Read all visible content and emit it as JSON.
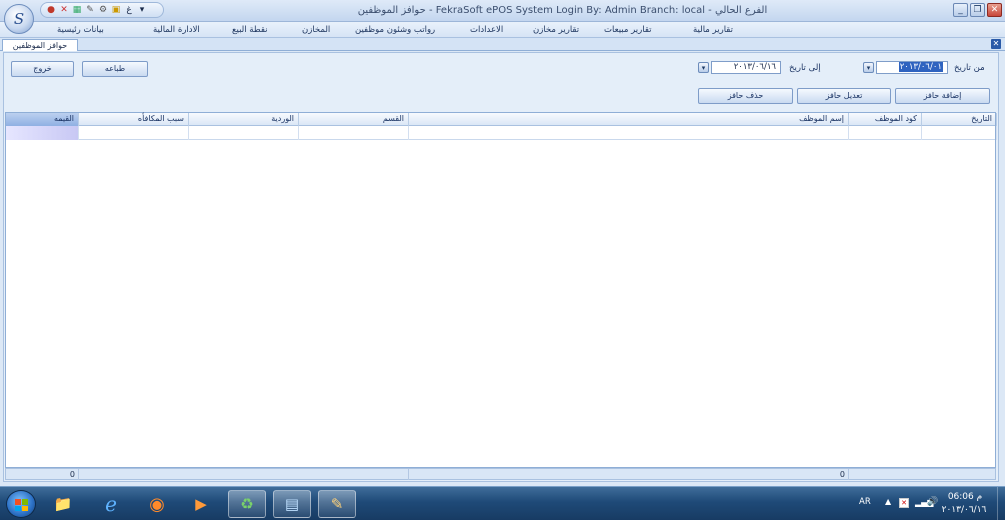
{
  "window": {
    "title": "حوافز الموظفين - FekraSoft ePOS System   Login By: Admin   Branch: local - الفرع الحالي",
    "orb_glyph": "S"
  },
  "qat": [
    "●",
    "✕",
    "▦",
    "✎",
    "⚙",
    "▣",
    "غ",
    "▾"
  ],
  "menu": [
    {
      "id": "financial-reports",
      "label": "تقارير مالية"
    },
    {
      "id": "sales-reports",
      "label": "تقارير مبيعات"
    },
    {
      "id": "stock-reports",
      "label": "تقارير مخازن"
    },
    {
      "id": "settings",
      "label": "الاعدادات"
    },
    {
      "id": "payroll",
      "label": "رواتب وشئون موظفين"
    },
    {
      "id": "stores",
      "label": "المخازن"
    },
    {
      "id": "pos",
      "label": "نقطة البيع"
    },
    {
      "id": "finance",
      "label": "الادارة المالية"
    },
    {
      "id": "master-data",
      "label": "بيانات رئيسية"
    }
  ],
  "tab": {
    "label": "حوافز الموظفين"
  },
  "filters": {
    "from_label": "من تاريخ",
    "from_value": "٢٠١٣/٠٦/٠١",
    "to_label": "إلى تاريخ",
    "to_value": "٢٠١٣/٠٦/١٦"
  },
  "buttons": {
    "exit": "خروج",
    "print": "طباعه",
    "add": "إضافة حافز",
    "edit": "تعديل حافز",
    "delete": "حذف حافز"
  },
  "grid": {
    "columns": [
      "التاريخ",
      "كود الموظف",
      "إسم الموظف",
      "القسم",
      "الوردية",
      "سبب المكافأه",
      "القيمه"
    ]
  },
  "footer": {
    "count_value": "0",
    "total_value": "0"
  },
  "taskbar": {
    "apps": [
      {
        "id": "explorer",
        "glyph": "📁"
      },
      {
        "id": "ie",
        "glyph": "ℯ"
      },
      {
        "id": "firefox",
        "glyph": "◉"
      },
      {
        "id": "media",
        "glyph": "▶"
      },
      {
        "id": "recycle",
        "glyph": "♻"
      },
      {
        "id": "remote",
        "glyph": "▤"
      },
      {
        "id": "paint",
        "glyph": "✎"
      }
    ],
    "lang": "AR",
    "time": "م 06:06",
    "date": "٢٠١٣/٠٦/١٦"
  }
}
